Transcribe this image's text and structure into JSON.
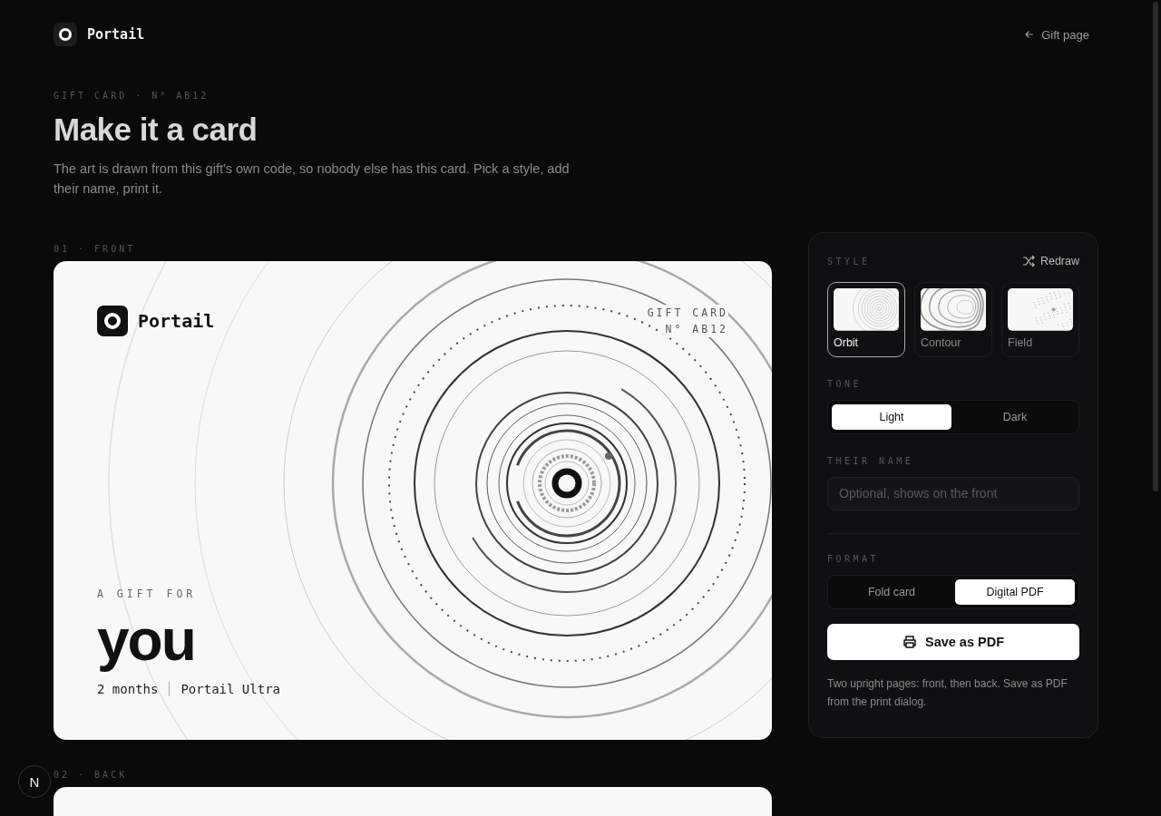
{
  "header": {
    "brand": "Portail",
    "back_link": "Gift page"
  },
  "intro": {
    "eyebrow": "GIFT CARD · N° AB12",
    "title": "Make it a card",
    "description": "The art is drawn from this gift's own code, so nobody else has this card. Pick a style, add their name, print it."
  },
  "front": {
    "label": "01 · FRONT",
    "brand": "Portail",
    "card_label": "GIFT CARD",
    "card_number": "N° AB12",
    "gift_for": "A GIFT FOR",
    "recipient": "you",
    "duration": "2 months",
    "plan": "Portail Ultra"
  },
  "back": {
    "label": "02 · BACK"
  },
  "panel": {
    "style_label": "STYLE",
    "redraw": "Redraw",
    "styles": [
      {
        "name": "Orbit",
        "kind": "orbit",
        "selected": true
      },
      {
        "name": "Contour",
        "kind": "contour",
        "selected": false
      },
      {
        "name": "Field",
        "kind": "field",
        "selected": false
      }
    ],
    "tone_label": "TONE",
    "tones": [
      {
        "label": "Light",
        "selected": true
      },
      {
        "label": "Dark",
        "selected": false
      }
    ],
    "name_label": "THEIR NAME",
    "name_placeholder": "Optional, shows on the front",
    "format_label": "FORMAT",
    "formats": [
      {
        "label": "Fold card",
        "selected": false
      },
      {
        "label": "Digital PDF",
        "selected": true
      }
    ],
    "save_button": "Save as PDF",
    "note": "Two upright pages: front, then back. Save as PDF from the print dialog."
  },
  "dev_badge": "N"
}
